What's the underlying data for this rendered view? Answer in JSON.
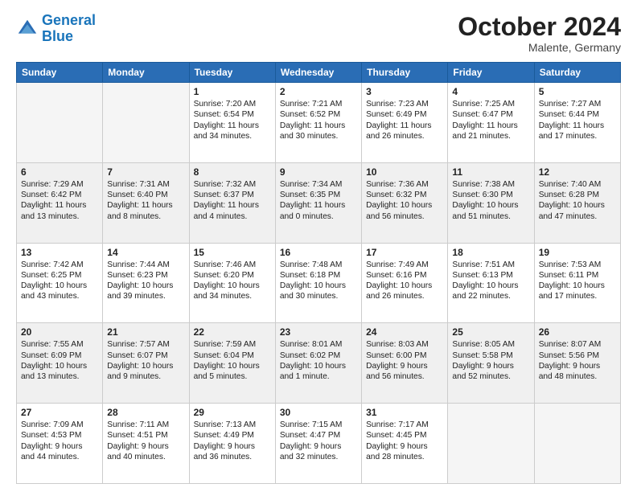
{
  "header": {
    "logo_line1": "General",
    "logo_line2": "Blue",
    "month": "October 2024",
    "location": "Malente, Germany"
  },
  "days_of_week": [
    "Sunday",
    "Monday",
    "Tuesday",
    "Wednesday",
    "Thursday",
    "Friday",
    "Saturday"
  ],
  "weeks": [
    [
      {
        "day": "",
        "info": ""
      },
      {
        "day": "",
        "info": ""
      },
      {
        "day": "1",
        "info": "Sunrise: 7:20 AM\nSunset: 6:54 PM\nDaylight: 11 hours\nand 34 minutes."
      },
      {
        "day": "2",
        "info": "Sunrise: 7:21 AM\nSunset: 6:52 PM\nDaylight: 11 hours\nand 30 minutes."
      },
      {
        "day": "3",
        "info": "Sunrise: 7:23 AM\nSunset: 6:49 PM\nDaylight: 11 hours\nand 26 minutes."
      },
      {
        "day": "4",
        "info": "Sunrise: 7:25 AM\nSunset: 6:47 PM\nDaylight: 11 hours\nand 21 minutes."
      },
      {
        "day": "5",
        "info": "Sunrise: 7:27 AM\nSunset: 6:44 PM\nDaylight: 11 hours\nand 17 minutes."
      }
    ],
    [
      {
        "day": "6",
        "info": "Sunrise: 7:29 AM\nSunset: 6:42 PM\nDaylight: 11 hours\nand 13 minutes."
      },
      {
        "day": "7",
        "info": "Sunrise: 7:31 AM\nSunset: 6:40 PM\nDaylight: 11 hours\nand 8 minutes."
      },
      {
        "day": "8",
        "info": "Sunrise: 7:32 AM\nSunset: 6:37 PM\nDaylight: 11 hours\nand 4 minutes."
      },
      {
        "day": "9",
        "info": "Sunrise: 7:34 AM\nSunset: 6:35 PM\nDaylight: 11 hours\nand 0 minutes."
      },
      {
        "day": "10",
        "info": "Sunrise: 7:36 AM\nSunset: 6:32 PM\nDaylight: 10 hours\nand 56 minutes."
      },
      {
        "day": "11",
        "info": "Sunrise: 7:38 AM\nSunset: 6:30 PM\nDaylight: 10 hours\nand 51 minutes."
      },
      {
        "day": "12",
        "info": "Sunrise: 7:40 AM\nSunset: 6:28 PM\nDaylight: 10 hours\nand 47 minutes."
      }
    ],
    [
      {
        "day": "13",
        "info": "Sunrise: 7:42 AM\nSunset: 6:25 PM\nDaylight: 10 hours\nand 43 minutes."
      },
      {
        "day": "14",
        "info": "Sunrise: 7:44 AM\nSunset: 6:23 PM\nDaylight: 10 hours\nand 39 minutes."
      },
      {
        "day": "15",
        "info": "Sunrise: 7:46 AM\nSunset: 6:20 PM\nDaylight: 10 hours\nand 34 minutes."
      },
      {
        "day": "16",
        "info": "Sunrise: 7:48 AM\nSunset: 6:18 PM\nDaylight: 10 hours\nand 30 minutes."
      },
      {
        "day": "17",
        "info": "Sunrise: 7:49 AM\nSunset: 6:16 PM\nDaylight: 10 hours\nand 26 minutes."
      },
      {
        "day": "18",
        "info": "Sunrise: 7:51 AM\nSunset: 6:13 PM\nDaylight: 10 hours\nand 22 minutes."
      },
      {
        "day": "19",
        "info": "Sunrise: 7:53 AM\nSunset: 6:11 PM\nDaylight: 10 hours\nand 17 minutes."
      }
    ],
    [
      {
        "day": "20",
        "info": "Sunrise: 7:55 AM\nSunset: 6:09 PM\nDaylight: 10 hours\nand 13 minutes."
      },
      {
        "day": "21",
        "info": "Sunrise: 7:57 AM\nSunset: 6:07 PM\nDaylight: 10 hours\nand 9 minutes."
      },
      {
        "day": "22",
        "info": "Sunrise: 7:59 AM\nSunset: 6:04 PM\nDaylight: 10 hours\nand 5 minutes."
      },
      {
        "day": "23",
        "info": "Sunrise: 8:01 AM\nSunset: 6:02 PM\nDaylight: 10 hours\nand 1 minute."
      },
      {
        "day": "24",
        "info": "Sunrise: 8:03 AM\nSunset: 6:00 PM\nDaylight: 9 hours\nand 56 minutes."
      },
      {
        "day": "25",
        "info": "Sunrise: 8:05 AM\nSunset: 5:58 PM\nDaylight: 9 hours\nand 52 minutes."
      },
      {
        "day": "26",
        "info": "Sunrise: 8:07 AM\nSunset: 5:56 PM\nDaylight: 9 hours\nand 48 minutes."
      }
    ],
    [
      {
        "day": "27",
        "info": "Sunrise: 7:09 AM\nSunset: 4:53 PM\nDaylight: 9 hours\nand 44 minutes."
      },
      {
        "day": "28",
        "info": "Sunrise: 7:11 AM\nSunset: 4:51 PM\nDaylight: 9 hours\nand 40 minutes."
      },
      {
        "day": "29",
        "info": "Sunrise: 7:13 AM\nSunset: 4:49 PM\nDaylight: 9 hours\nand 36 minutes."
      },
      {
        "day": "30",
        "info": "Sunrise: 7:15 AM\nSunset: 4:47 PM\nDaylight: 9 hours\nand 32 minutes."
      },
      {
        "day": "31",
        "info": "Sunrise: 7:17 AM\nSunset: 4:45 PM\nDaylight: 9 hours\nand 28 minutes."
      },
      {
        "day": "",
        "info": ""
      },
      {
        "day": "",
        "info": ""
      }
    ]
  ]
}
